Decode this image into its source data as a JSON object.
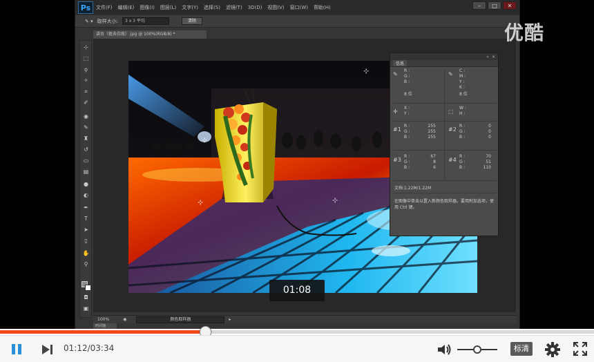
{
  "watermark": "优酷",
  "photoshop": {
    "logo": "Ps",
    "menu": [
      "文件(F)",
      "编辑(E)",
      "图像(I)",
      "图层(L)",
      "文字(Y)",
      "选择(S)",
      "滤镜(T)",
      "3D(D)",
      "视图(V)",
      "窗口(W)",
      "帮助(H)"
    ],
    "options": {
      "sample_label": "取样大小:",
      "sample_value": "3 x 3 平均",
      "clear_button": "清除"
    },
    "document_tab": "讲台（抠去白底）.jpg @ 100%(RGB/8) *",
    "status": {
      "zoom": "100%",
      "tool": "颜色取样器"
    },
    "bottom_tab": "时间轴",
    "info_panel": {
      "tab": "信息",
      "rgb1_labels": [
        "R :",
        "G :",
        "B :"
      ],
      "cmyk_labels": [
        "C :",
        "M :",
        "Y :",
        "K :"
      ],
      "bit1": "8 位",
      "bit2": "8 位",
      "xy_labels": [
        "X :",
        "Y :"
      ],
      "wh_labels": [
        "W :",
        "H :"
      ],
      "samplers": [
        {
          "id": "#1",
          "labels": [
            "R :",
            "G :",
            "B :"
          ],
          "values": [
            "255",
            "255",
            "255"
          ]
        },
        {
          "id": "#2",
          "labels": [
            "R :",
            "G :",
            "B :"
          ],
          "values": [
            "0",
            "0",
            "0"
          ]
        },
        {
          "id": "#3",
          "labels": [
            "R :",
            "G :",
            "B :"
          ],
          "values": [
            "67",
            "8",
            "6"
          ]
        },
        {
          "id": "#4",
          "labels": [
            "R :",
            "G :",
            "B :"
          ],
          "values": [
            "70",
            "51",
            "110"
          ]
        }
      ],
      "doc_size": "文档:1.22M/1.22M",
      "hint": "在图像中单击以置入新颜色取样器。要用附加选项，使用 Ctrl 键。"
    }
  },
  "video": {
    "time_bubble": "01:08",
    "progress_fraction": 0.345,
    "time_display": "01:12/03:34",
    "volume_fraction": 0.5,
    "quality_label": "标清"
  },
  "colors": {
    "accent_progress": "#f04a1a",
    "accent_pause": "#2a8fd8"
  }
}
